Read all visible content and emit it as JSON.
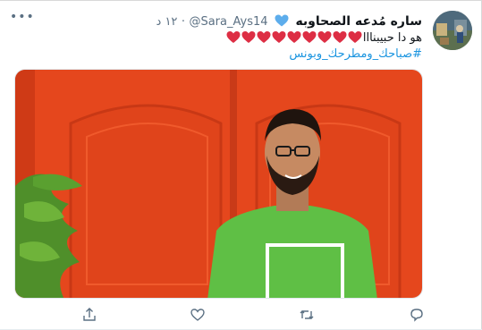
{
  "tweet": {
    "author_name": "ساره مُدعه الصحاوبه",
    "handle": "@Sara_Ays14",
    "dot": "·",
    "time": "١٢ د",
    "text": "هو دا حبيبنااا",
    "hearts_count": 9,
    "hashtag": "#صباحك_ومطرحك_وبونس"
  },
  "icons": {
    "verified_heart": "blue-heart-icon",
    "text_hearts": "red-heart-icon",
    "more": "more-dots-icon",
    "reply": "reply-icon",
    "retweet": "retweet-icon",
    "like": "like-icon",
    "share": "share-icon"
  },
  "colors": {
    "name": "#0f1419",
    "secondary": "#5b7083",
    "hashtag": "#1b95e0",
    "heart_red": "#dd2e44",
    "heart_blue": "#5dadec",
    "photo_wall": "#e5471d",
    "shirt": "#5fbf45"
  }
}
